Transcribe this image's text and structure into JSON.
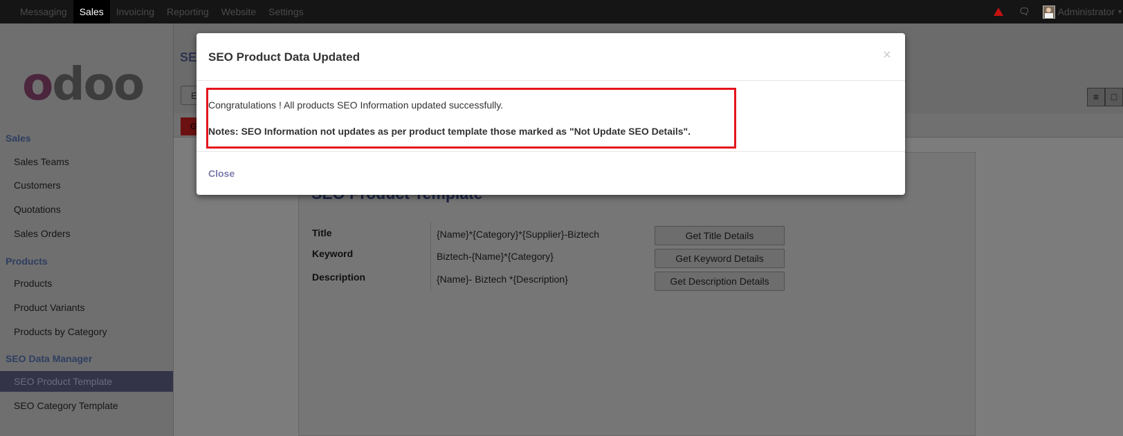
{
  "topbar": {
    "menu": [
      "Messaging",
      "Sales",
      "Invoicing",
      "Reporting",
      "Website",
      "Settings"
    ],
    "active": "Sales",
    "user": "Administrator"
  },
  "sidebar": {
    "logo": {
      "first": "o",
      "rest": "doo"
    },
    "sections": [
      {
        "title": "Sales",
        "items": [
          "Sales Teams",
          "Customers",
          "Quotations",
          "Sales Orders"
        ]
      },
      {
        "title": "Products",
        "items": [
          "Products",
          "Product Variants",
          "Products by Category"
        ]
      },
      {
        "title": "SEO Data Manager",
        "items": [
          "SEO Product Template",
          "SEO Category Template"
        ]
      }
    ],
    "active_item": "SEO Product Template"
  },
  "main": {
    "breadcrumb": "SE",
    "edit_label": "E",
    "gen_label": "G",
    "sheet": {
      "title": "SEO Product Template",
      "fields": [
        {
          "label": "Title",
          "value": "{Name}*{Category}*{Supplier}-Biztech",
          "button": "Get Title Details"
        },
        {
          "label": "Keyword",
          "value": "Biztech-{Name}*{Category}",
          "button": "Get Keyword Details"
        },
        {
          "label": "Description",
          "value": "{Name}- Biztech *{Description}",
          "button": "Get Description Details"
        }
      ]
    }
  },
  "modal": {
    "title": "SEO Product Data Updated",
    "close_x": "×",
    "message": "Congratulations ! All products SEO Information updated successfully.",
    "note": "Notes: SEO Information not updates as per product template those marked as \"Not Update SEO Details\".",
    "close_label": "Close"
  },
  "colors": {
    "highlight_border": "#e4141b",
    "link": "#7c7bad",
    "topbar": "#151515"
  }
}
